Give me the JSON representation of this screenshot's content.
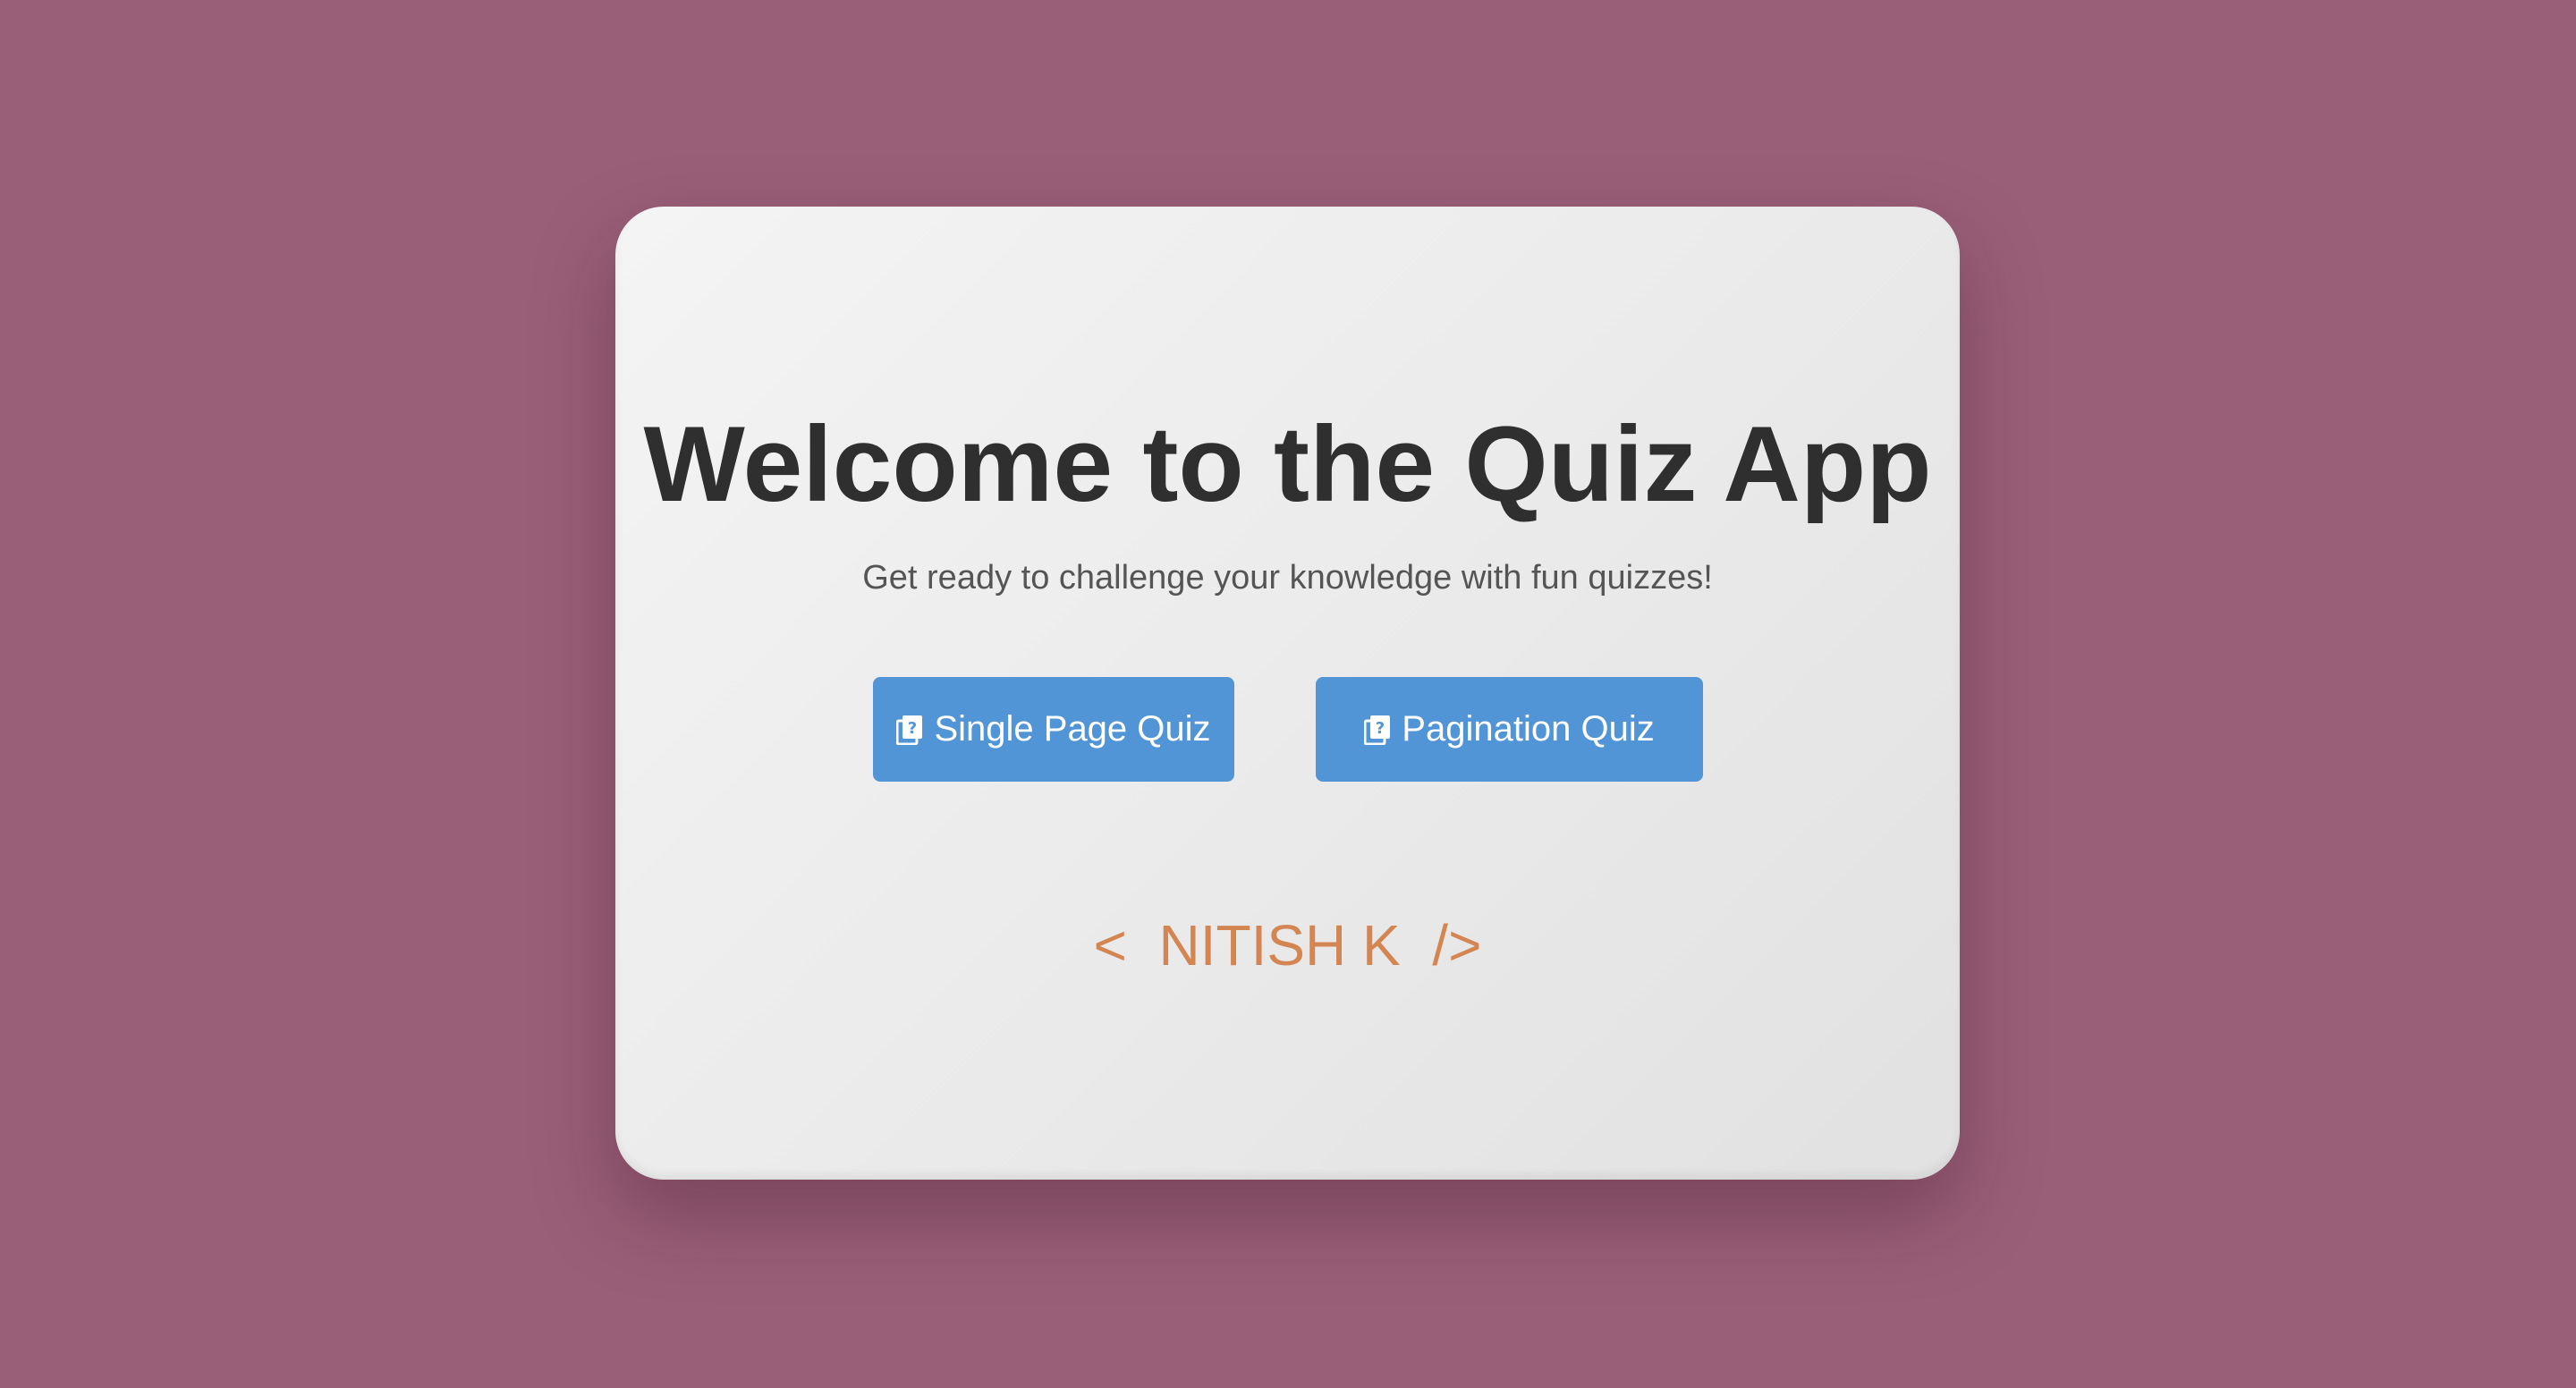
{
  "page": {
    "background_color": "#9a5f78"
  },
  "card": {
    "title": "Welcome to the Quiz App",
    "subtitle": "Get ready to challenge your knowledge with fun quizzes!",
    "buttons": [
      {
        "label": "Single Page Quiz",
        "icon": "quiz-icon",
        "color": "#5295d6"
      },
      {
        "label": "Pagination Quiz",
        "icon": "quiz-icon",
        "color": "#5295d6"
      }
    ],
    "signature": {
      "open": "<",
      "name": "NITISH K",
      "close": "/>",
      "color": "#d48652"
    }
  }
}
